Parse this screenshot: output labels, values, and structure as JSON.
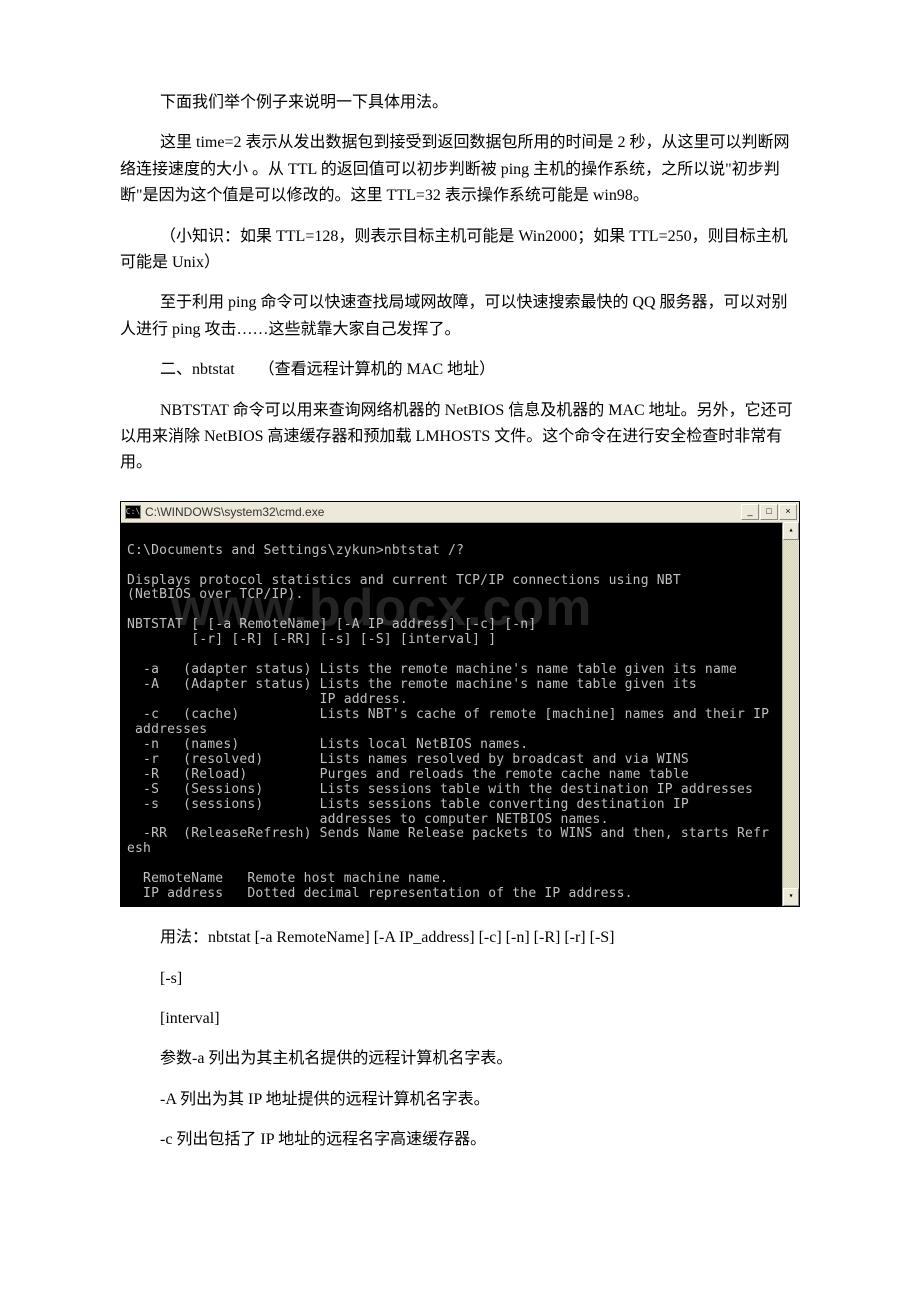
{
  "para": {
    "p1": "下面我们举个例子来说明一下具体用法。",
    "p2": "这里 time=2 表示从发出数据包到接受到返回数据包所用的时间是 2 秒，从这里可以判断网络连接速度的大小 。从 TTL 的返回值可以初步判断被 ping 主机的操作系统，之所以说\"初步判断\"是因为这个值是可以修改的。这里 TTL=32 表示操作系统可能是 win98。",
    "p3": "（小知识：如果 TTL=128，则表示目标主机可能是 Win2000；如果 TTL=250，则目标主机可能是 Unix）",
    "p4": "至于利用 ping 命令可以快速查找局域网故障，可以快速搜索最快的 QQ 服务器，可以对别人进行 ping 攻击……这些就靠大家自己发挥了。",
    "p5": "二、nbtstat　　（查看远程计算机的 MAC 地址）",
    "p6": "NBTSTAT 命令可以用来查询网络机器的 NetBIOS 信息及机器的 MAC 地址。另外，它还可以用来消除 NetBIOS 高速缓存器和预加载 LMHOSTS 文件。这个命令在进行安全检查时非常有用。",
    "p7": "用法：nbtstat [-a RemoteName] [-A IP_address] [-c] [-n] [-R] [-r] [-S]",
    "p8": "[-s]",
    "p9": "[interval]",
    "p10": "参数-a 列出为其主机名提供的远程计算机名字表。",
    "p11": "-A 列出为其 IP 地址提供的远程计算机名字表。",
    "p12": "-c 列出包括了 IP 地址的远程名字高速缓存器。"
  },
  "terminal": {
    "title": "C:\\WINDOWS\\system32\\cmd.exe",
    "icon_label": "C:\\",
    "btn_min": "_",
    "btn_max": "□",
    "btn_close": "×",
    "sb_up": "▴",
    "sb_down": "▾",
    "content": "\nC:\\Documents and Settings\\zykun>nbtstat /?\n\nDisplays protocol statistics and current TCP/IP connections using NBT\n(NetBIOS over TCP/IP).\n\nNBTSTAT [ [-a RemoteName] [-A IP address] [-c] [-n]\n        [-r] [-R] [-RR] [-s] [-S] [interval] ]\n\n  -a   (adapter status) Lists the remote machine's name table given its name\n  -A   (Adapter status) Lists the remote machine's name table given its\n                        IP address.\n  -c   (cache)          Lists NBT's cache of remote [machine] names and their IP\n addresses\n  -n   (names)          Lists local NetBIOS names.\n  -r   (resolved)       Lists names resolved by broadcast and via WINS\n  -R   (Reload)         Purges and reloads the remote cache name table\n  -S   (Sessions)       Lists sessions table with the destination IP addresses\n  -s   (sessions)       Lists sessions table converting destination IP\n                        addresses to computer NETBIOS names.\n  -RR  (ReleaseRefresh) Sends Name Release packets to WINS and then, starts Refr\nesh\n\n  RemoteName   Remote host machine name.\n  IP address   Dotted decimal representation of the IP address."
  },
  "watermark": "www.bdocx.com"
}
